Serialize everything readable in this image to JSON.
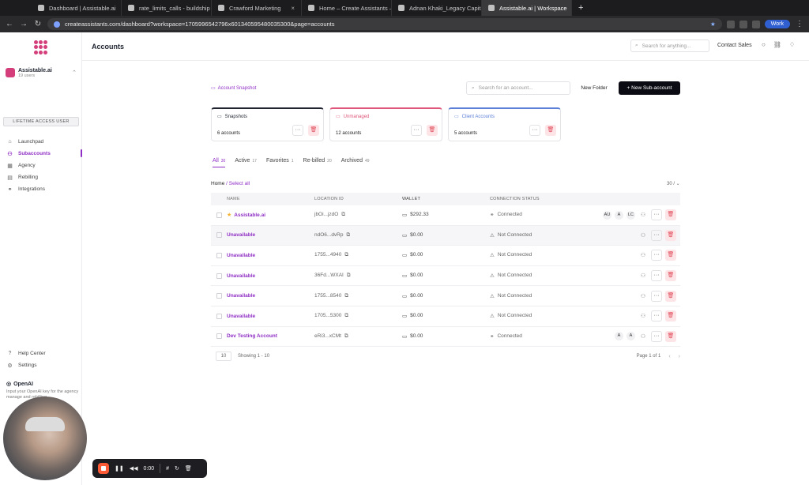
{
  "browser": {
    "tabs": [
      {
        "title": "Dashboard | Assistable.ai",
        "active": false
      },
      {
        "title": "rate_limits_calls - buildship",
        "active": false
      },
      {
        "title": "Crawford Marketing",
        "active": false
      },
      {
        "title": "Home – Create Assistants – G",
        "active": false
      },
      {
        "title": "Adnan Khaki_Legacy Capital",
        "active": false
      },
      {
        "title": "Assistable.ai | Workspace",
        "active": true
      }
    ],
    "url": "createassistants.com/dashboard?workspace=1705996542796x601340595480035300&page=accounts",
    "profile": "Work"
  },
  "sidebar": {
    "workspace_name": "Assistable.ai",
    "workspace_sub": "19 users",
    "lifetime_label": "LIFETIME ACCESS USER",
    "items": [
      {
        "label": "Launchpad",
        "icon": "rocket-icon",
        "active": false
      },
      {
        "label": "Subaccounts",
        "icon": "users-icon",
        "active": true
      },
      {
        "label": "Agency",
        "icon": "building-icon",
        "active": false
      },
      {
        "label": "Rebilling",
        "icon": "receipt-icon",
        "active": false
      },
      {
        "label": "Integrations",
        "icon": "link-icon",
        "active": false
      }
    ],
    "bottom_items": [
      {
        "label": "Help Center",
        "icon": "help-icon"
      },
      {
        "label": "Settings",
        "icon": "gear-icon"
      }
    ],
    "openai_title": "OpenAI",
    "openai_desc": "Input your OpenAI key for the agency manage and rebilling"
  },
  "header": {
    "title": "Accounts",
    "search_placeholder": "Search for anything...",
    "contact_sales": "Contact Sales"
  },
  "toolbar": {
    "snapshot_link": "Account Snapshot",
    "search_placeholder": "Search for an account...",
    "new_folder": "New Folder",
    "new_subaccount": "+ New Sub-account"
  },
  "folders": [
    {
      "title": "Snapshots",
      "count": "6 accounts",
      "color": "#1f2430"
    },
    {
      "title": "Unmanaged",
      "count": "12 accounts",
      "color": "#e0567a"
    },
    {
      "title": "Client Accounts",
      "count": "5 accounts",
      "color": "#5b7fd6"
    }
  ],
  "filter_tabs": [
    {
      "label": "All",
      "count": "30",
      "active": true
    },
    {
      "label": "Active",
      "count": "17",
      "active": false
    },
    {
      "label": "Favorites",
      "count": "1",
      "active": false
    },
    {
      "label": "Re-billed",
      "count": "20",
      "active": false
    },
    {
      "label": "Archived",
      "count": "49",
      "active": false
    }
  ],
  "breadcrumb": {
    "home": "Home",
    "select_all": "/ Select all"
  },
  "per_page_label": "30 / ⌄",
  "table": {
    "columns": [
      "NAME",
      "LOCATION ID",
      "WALLET",
      "CONNECTION STATUS"
    ],
    "rows": [
      {
        "name": "Assistable.ai",
        "starred": true,
        "location": "jbOi...jzdO",
        "wallet": "$292.33",
        "status": "Connected",
        "badges": [
          "AU",
          "A",
          "LC"
        ],
        "hover": false
      },
      {
        "name": "Unavailable",
        "starred": false,
        "location": "ndO6...dvRp",
        "wallet": "$0.00",
        "status": "Not Connected",
        "badges": [],
        "hover": true
      },
      {
        "name": "Unavailable",
        "starred": false,
        "location": "1755...4940",
        "wallet": "$0.00",
        "status": "Not Connected",
        "badges": [],
        "hover": false
      },
      {
        "name": "Unavailable",
        "starred": false,
        "location": "36Fd...WXAI",
        "wallet": "$0.00",
        "status": "Not Connected",
        "badges": [],
        "hover": false
      },
      {
        "name": "Unavailable",
        "starred": false,
        "location": "1755...8540",
        "wallet": "$0.00",
        "status": "Not Connected",
        "badges": [],
        "hover": false
      },
      {
        "name": "Unavailable",
        "starred": false,
        "location": "1705...5300",
        "wallet": "$0.00",
        "status": "Not Connected",
        "badges": [],
        "hover": false
      },
      {
        "name": "Dev Testing Account",
        "starred": false,
        "location": "eRi3...xCMt",
        "wallet": "$0.00",
        "status": "Connected",
        "badges": [
          "A",
          "A"
        ],
        "hover": false
      }
    ]
  },
  "footer": {
    "page_size": "10",
    "showing": "Showing 1 - 10",
    "page": "Page 1 of 1"
  },
  "recorder": {
    "time": "0:00"
  }
}
